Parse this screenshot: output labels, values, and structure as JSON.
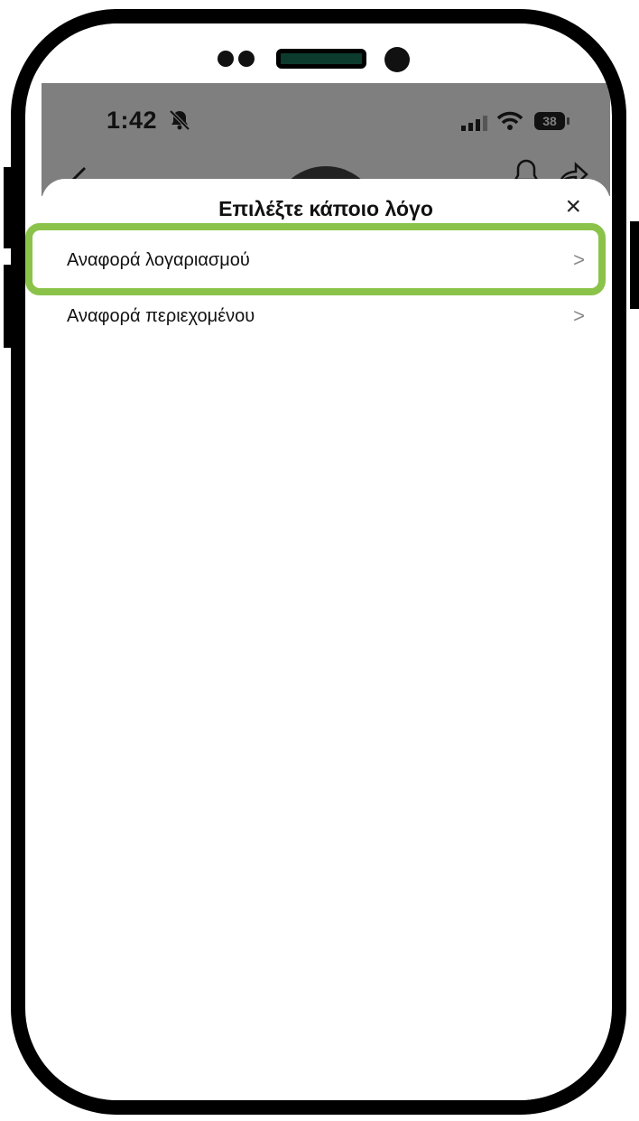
{
  "status_bar": {
    "time": "1:42",
    "battery": "38"
  },
  "sheet": {
    "title": "Επιλέξτε κάποιο λόγο",
    "items": [
      {
        "label": "Αναφορά λογαριασμού"
      },
      {
        "label": "Αναφορά περιεχομένου"
      }
    ]
  },
  "colors": {
    "highlight": "#8bc34a",
    "status_bg": "#7f7f7f"
  },
  "icons": [
    "bell-off-icon",
    "signal-icon",
    "wifi-icon",
    "battery-icon",
    "back-icon",
    "bell-icon",
    "share-icon",
    "close-icon",
    "chevron-right-icon"
  ]
}
